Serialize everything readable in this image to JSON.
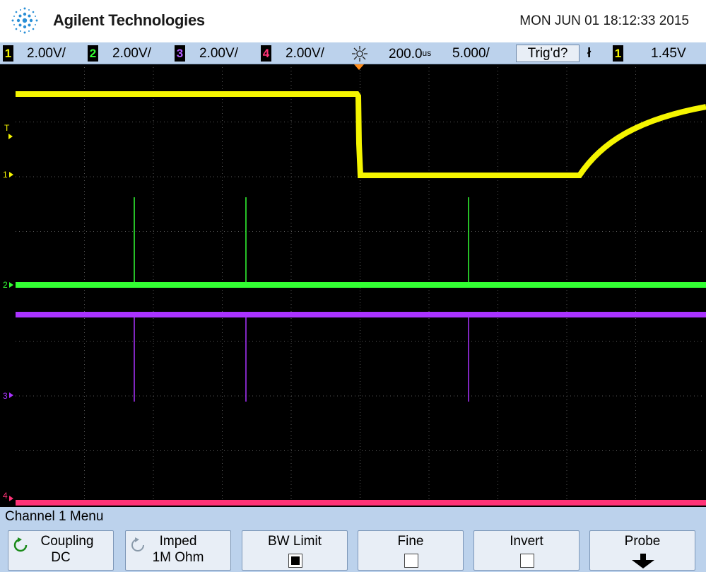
{
  "header": {
    "brand": "Agilent Technologies",
    "datetime": "MON JUN 01 18:12:33 2015"
  },
  "status_bar": {
    "channels": [
      {
        "number": "1",
        "scale": "2.00V/",
        "color": "#f5f500"
      },
      {
        "number": "2",
        "scale": "2.00V/",
        "color": "#33ff33"
      },
      {
        "number": "3",
        "scale": "2.00V/",
        "color": "#b35cff"
      },
      {
        "number": "4",
        "scale": "2.00V/",
        "color": "#ff3377"
      }
    ],
    "timebase": "200.0",
    "timebase_unit": "us",
    "sample_rate": "5.000",
    "sample_unit": "/",
    "trigger_state": "Trig'd?",
    "trigger_edge": "ł",
    "trigger_source": "1",
    "trigger_level": "1.45V"
  },
  "markers": {
    "trigger_level": "T",
    "ch1": "1",
    "ch2": "2",
    "ch3": "3",
    "ch4": "4"
  },
  "menu": {
    "title": "Channel 1  Menu",
    "softkeys": [
      {
        "line1": "Coupling",
        "line2": "DC"
      },
      {
        "line1": "Imped",
        "line2": "1M Ohm"
      },
      {
        "line1": "BW Limit",
        "checked": true
      },
      {
        "line1": "Fine",
        "checked": false
      },
      {
        "line1": "Invert",
        "checked": false
      },
      {
        "line1": "Probe"
      }
    ]
  },
  "colors": {
    "ch1": "#f5f500",
    "ch2": "#33ff33",
    "ch3": "#aa33ff",
    "ch4": "#ff3377",
    "grid": "#5a5a5a",
    "status_bg": "#bcd2ec"
  }
}
